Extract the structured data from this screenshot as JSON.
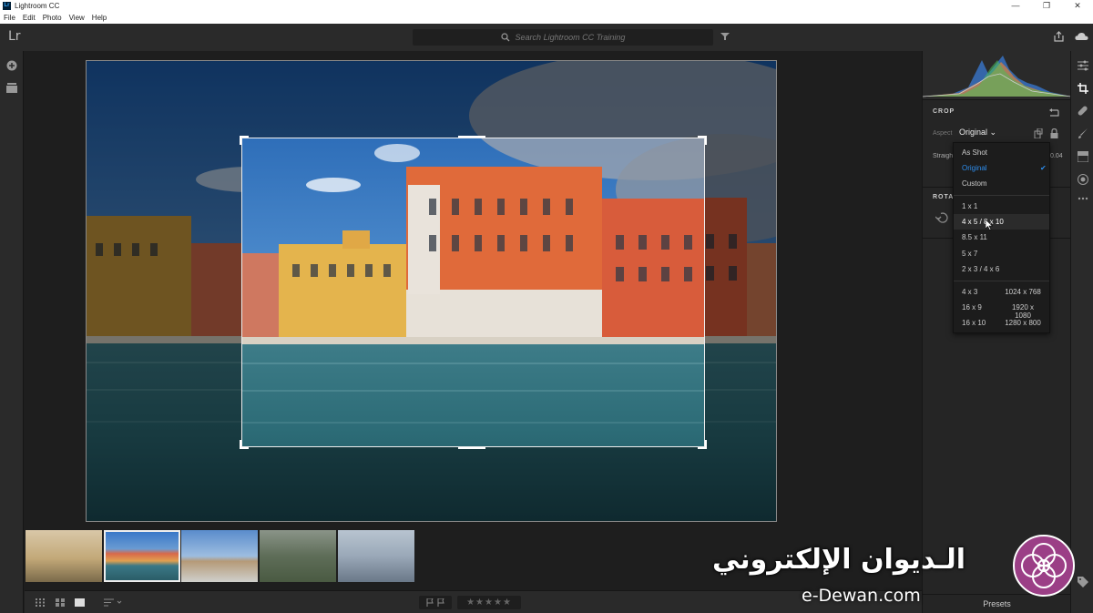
{
  "window": {
    "title": "Lightroom CC",
    "logo_text": "Lr"
  },
  "menu": [
    "File",
    "Edit",
    "Photo",
    "View",
    "Help"
  ],
  "app_logo": "Lr",
  "search": {
    "placeholder": "Search Lightroom CC Training"
  },
  "crop_panel": {
    "title": "CROP",
    "aspect_label": "Aspect",
    "aspect_value": "Original",
    "straighten_label": "Straighten",
    "straighten_value": "0.04",
    "rotate_title": "ROTATE & FLIP"
  },
  "aspect_menu": {
    "items": [
      {
        "label": "As Shot",
        "active": false
      },
      {
        "label": "Original",
        "active": true
      },
      {
        "label": "Custom",
        "active": false
      },
      {
        "label": "1 x 1",
        "active": false
      },
      {
        "label": "4 x 5  /  8 x 10",
        "active": false,
        "hover": true
      },
      {
        "label": "8.5 x 11",
        "active": false
      },
      {
        "label": "5 x 7",
        "active": false
      },
      {
        "label": "2 x 3  /  4 x 6",
        "active": false
      },
      {
        "label": "4 x 3",
        "res": "1024 x 768"
      },
      {
        "label": "16 x 9",
        "res": "1920 x 1080"
      },
      {
        "label": "16 x 10",
        "res": "1280 x 800"
      }
    ]
  },
  "bottom": {
    "presets_label": "Presets",
    "stars": "★★★★★"
  },
  "watermark": {
    "arabic": "الـديوان الإلكتروني",
    "url": "e-Dewan.com"
  },
  "colors": {
    "accent": "#2d8ceb",
    "panel": "#252525",
    "background": "#1e1e1e"
  }
}
